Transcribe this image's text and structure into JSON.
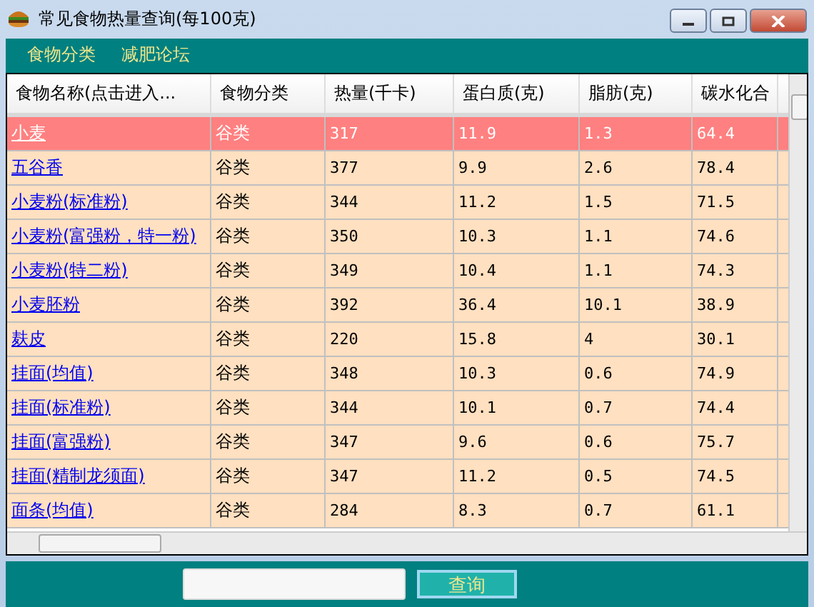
{
  "window": {
    "title": "常见食物热量查询(每100克)"
  },
  "menu": [
    "食物分类",
    "减肥论坛"
  ],
  "table": {
    "columns": [
      "食物名称(点击进入...",
      "食物分类",
      "热量(千卡)",
      "蛋白质(克)",
      "脂肪(克)",
      "碳水化合"
    ],
    "rows": [
      {
        "selected": true,
        "cells": [
          "小麦",
          "谷类",
          "317",
          "11.9",
          "1.3",
          "64.4"
        ]
      },
      {
        "selected": false,
        "cells": [
          "五谷香",
          "谷类",
          "377",
          "9.9",
          "2.6",
          "78.4"
        ]
      },
      {
        "selected": false,
        "cells": [
          "小麦粉(标准粉)",
          "谷类",
          "344",
          "11.2",
          "1.5",
          "71.5"
        ]
      },
      {
        "selected": false,
        "cells": [
          "小麦粉(富强粉，特一粉)",
          "谷类",
          "350",
          "10.3",
          "1.1",
          "74.6"
        ]
      },
      {
        "selected": false,
        "cells": [
          "小麦粉(特二粉)",
          "谷类",
          "349",
          "10.4",
          "1.1",
          "74.3"
        ]
      },
      {
        "selected": false,
        "cells": [
          "小麦胚粉",
          "谷类",
          "392",
          "36.4",
          "10.1",
          "38.9"
        ]
      },
      {
        "selected": false,
        "cells": [
          "麸皮",
          "谷类",
          "220",
          "15.8",
          "4",
          "30.1"
        ]
      },
      {
        "selected": false,
        "cells": [
          "挂面(均值)",
          "谷类",
          "348",
          "10.3",
          "0.6",
          "74.9"
        ]
      },
      {
        "selected": false,
        "cells": [
          "挂面(标准粉)",
          "谷类",
          "344",
          "10.1",
          "0.7",
          "74.4"
        ]
      },
      {
        "selected": false,
        "cells": [
          "挂面(富强粉)",
          "谷类",
          "347",
          "9.6",
          "0.6",
          "75.7"
        ]
      },
      {
        "selected": false,
        "cells": [
          "挂面(精制龙须面)",
          "谷类",
          "347",
          "11.2",
          "0.5",
          "74.5"
        ]
      },
      {
        "selected": false,
        "cells": [
          "面条(均值)",
          "谷类",
          "284",
          "8.3",
          "0.7",
          "61.1"
        ]
      }
    ]
  },
  "search": {
    "button": "查询"
  }
}
